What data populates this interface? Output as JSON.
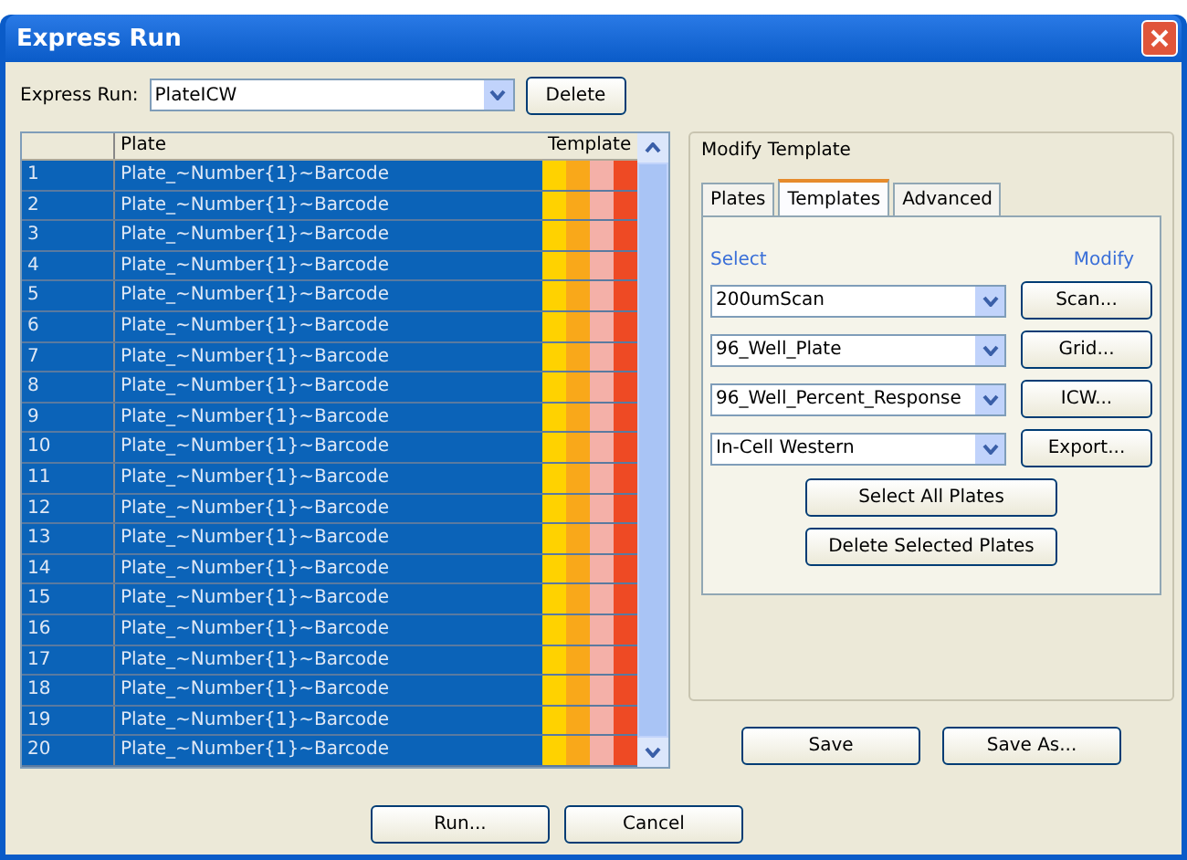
{
  "window": {
    "title": "Express Run"
  },
  "express_run": {
    "label": "Express Run:",
    "value": "PlateICW",
    "delete_button": "Delete"
  },
  "table": {
    "columns": [
      "Plate",
      "Template"
    ],
    "rows": [
      {
        "number": "1",
        "plate": "Plate_~Number{1}~Barcode",
        "selected": true
      },
      {
        "number": "2",
        "plate": "Plate_~Number{1}~Barcode",
        "selected": true
      },
      {
        "number": "3",
        "plate": "Plate_~Number{1}~Barcode",
        "selected": true
      },
      {
        "number": "4",
        "plate": "Plate_~Number{1}~Barcode",
        "selected": true
      },
      {
        "number": "5",
        "plate": "Plate_~Number{1}~Barcode",
        "selected": true
      },
      {
        "number": "6",
        "plate": "Plate_~Number{1}~Barcode",
        "selected": true
      },
      {
        "number": "7",
        "plate": "Plate_~Number{1}~Barcode",
        "selected": true
      },
      {
        "number": "8",
        "plate": "Plate_~Number{1}~Barcode",
        "selected": true
      },
      {
        "number": "9",
        "plate": "Plate_~Number{1}~Barcode",
        "selected": true
      },
      {
        "number": "10",
        "plate": "Plate_~Number{1}~Barcode",
        "selected": true
      },
      {
        "number": "11",
        "plate": "Plate_~Number{1}~Barcode",
        "selected": true
      },
      {
        "number": "12",
        "plate": "Plate_~Number{1}~Barcode",
        "selected": true
      },
      {
        "number": "13",
        "plate": "Plate_~Number{1}~Barcode",
        "selected": true
      },
      {
        "number": "14",
        "plate": "Plate_~Number{1}~Barcode",
        "selected": true
      },
      {
        "number": "15",
        "plate": "Plate_~Number{1}~Barcode",
        "selected": true
      },
      {
        "number": "16",
        "plate": "Plate_~Number{1}~Barcode",
        "selected": true
      },
      {
        "number": "17",
        "plate": "Plate_~Number{1}~Barcode",
        "selected": true
      },
      {
        "number": "18",
        "plate": "Plate_~Number{1}~Barcode",
        "selected": true
      },
      {
        "number": "19",
        "plate": "Plate_~Number{1}~Barcode",
        "selected": true
      },
      {
        "number": "20",
        "plate": "Plate_~Number{1}~Barcode",
        "selected": true
      }
    ]
  },
  "modify_template": {
    "title": "Modify Template",
    "tabs": [
      {
        "label": "Plates",
        "selected": false
      },
      {
        "label": "Templates",
        "selected": true
      },
      {
        "label": "Advanced",
        "selected": false
      }
    ],
    "select_label": "Select",
    "modify_label": "Modify",
    "templates": [
      {
        "value": "200umScan",
        "button": "Scan..."
      },
      {
        "value": "96_Well_Plate",
        "button": "Grid..."
      },
      {
        "value": "96_Well_Percent_Response",
        "button": "ICW..."
      },
      {
        "value": "In-Cell Western",
        "button": "Export..."
      }
    ],
    "actions": [
      "Select All Plates",
      "Delete Selected Plates"
    ],
    "save_buttons": [
      "Save",
      "Save As..."
    ]
  },
  "footer_buttons": [
    "Run...",
    "Cancel"
  ]
}
